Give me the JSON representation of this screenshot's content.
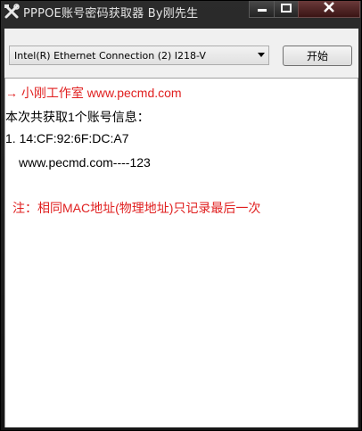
{
  "window": {
    "title": "PPPOE账号密码获取器 By刚先生"
  },
  "toolbar": {
    "adapter_selected": "Intel(R) Ethernet Connection (2) I218-V",
    "start_label": "开始"
  },
  "output": {
    "line_credit": "→ 小刚工作室 www.pecmd.com",
    "line_summary": "本次共获取1个账号信息：",
    "line_mac": "1. 14:CF:92:6F:DC:A7",
    "line_account": "www.pecmd.com----123",
    "line_note": "注：相同MAC地址(物理地址)只记录最后一次"
  },
  "colors": {
    "highlight": "#e02020",
    "background": "#ffffff",
    "titlebar": "#1c1c1c"
  },
  "icons": {
    "app": "tools-icon",
    "minimize": "minimize-icon",
    "maximize": "maximize-icon",
    "close": "close-icon",
    "dropdown": "chevron-down-icon"
  }
}
